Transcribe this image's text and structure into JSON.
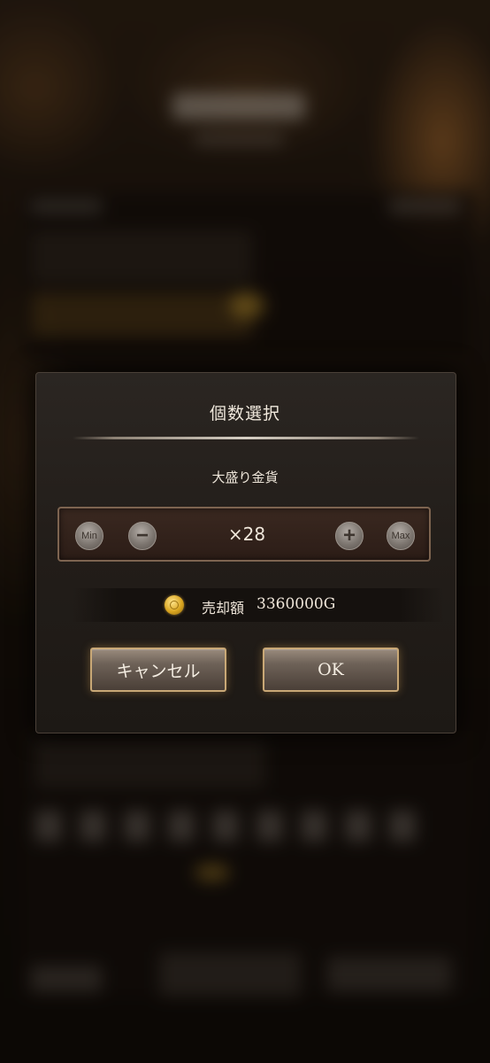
{
  "dialog": {
    "title": "個数選択",
    "item_name": "大盛り金貨",
    "stepper": {
      "min_label": "Min",
      "minus_symbol": "−",
      "quantity_text": "×28",
      "plus_symbol": "+",
      "max_label": "Max"
    },
    "sale": {
      "icon": "gold-coin-icon",
      "label": "売却額",
      "value": "3360000G"
    },
    "buttons": {
      "cancel_label": "キャンセル",
      "ok_label": "OK"
    }
  },
  "colors": {
    "dialog_bg": "#221d19",
    "stepper_border": "#7d6450",
    "button_glow": "#c9a876",
    "coin": "#d9a520",
    "text": "#efe6da"
  }
}
